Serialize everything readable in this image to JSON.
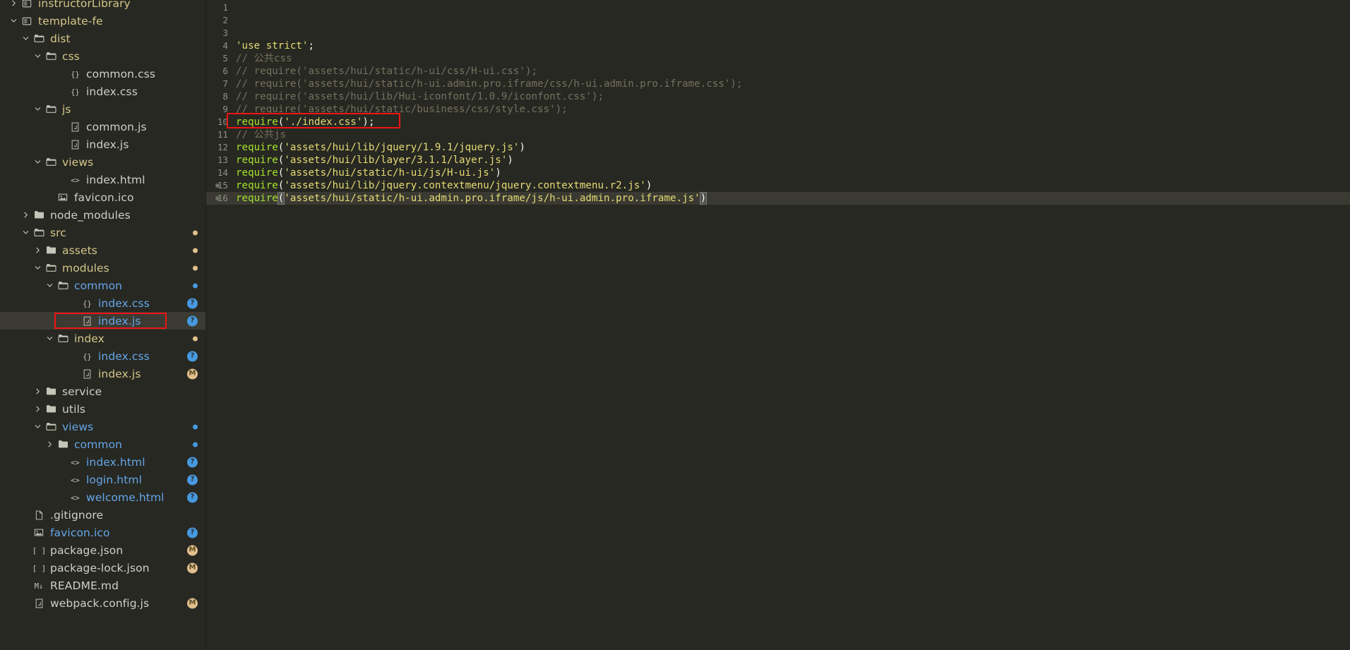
{
  "window": {
    "theme": "monokai-dark",
    "editor_background": "#272822",
    "sidebar_background": "#272822",
    "selection_outline_color": "#f01414",
    "active_line_background": "#3a3a32"
  },
  "sidebar": {
    "name": "explorer-file-tree",
    "items": [
      {
        "label": "instructorLibrary",
        "depth": 0,
        "kind": "root-folder",
        "icon": "root-folder-icon",
        "twisty": "collapsed",
        "color": "folder-amber",
        "badge": null,
        "clipped_top": true
      },
      {
        "label": "template-fe",
        "depth": 0,
        "kind": "root-folder",
        "icon": "root-folder-icon",
        "twisty": "expanded",
        "color": "folder-amber",
        "badge": null
      },
      {
        "label": "dist",
        "depth": 1,
        "kind": "folder",
        "icon": "folder-open-icon",
        "twisty": "expanded",
        "color": "folder-amber",
        "badge": null
      },
      {
        "label": "css",
        "depth": 2,
        "kind": "folder",
        "icon": "folder-open-icon",
        "twisty": "expanded",
        "color": "folder-amber",
        "badge": null
      },
      {
        "label": "common.css",
        "depth": 4,
        "kind": "file",
        "icon": "css-file-icon",
        "twisty": "none",
        "color": "plain",
        "badge": null
      },
      {
        "label": "index.css",
        "depth": 4,
        "kind": "file",
        "icon": "css-file-icon",
        "twisty": "none",
        "color": "plain",
        "badge": null
      },
      {
        "label": "js",
        "depth": 2,
        "kind": "folder",
        "icon": "folder-open-icon",
        "twisty": "expanded",
        "color": "folder-amber",
        "badge": null
      },
      {
        "label": "common.js",
        "depth": 4,
        "kind": "file",
        "icon": "js-file-icon",
        "twisty": "none",
        "color": "plain",
        "badge": null
      },
      {
        "label": "index.js",
        "depth": 4,
        "kind": "file",
        "icon": "js-file-icon",
        "twisty": "none",
        "color": "plain",
        "badge": null
      },
      {
        "label": "views",
        "depth": 2,
        "kind": "folder",
        "icon": "folder-open-icon",
        "twisty": "expanded",
        "color": "folder-amber",
        "badge": null
      },
      {
        "label": "index.html",
        "depth": 4,
        "kind": "file",
        "icon": "html-file-icon",
        "twisty": "none",
        "color": "plain",
        "badge": null
      },
      {
        "label": "favicon.ico",
        "depth": 3,
        "kind": "file",
        "icon": "image-file-icon",
        "twisty": "none",
        "color": "plain",
        "badge": null
      },
      {
        "label": "node_modules",
        "depth": 1,
        "kind": "folder",
        "icon": "folder-icon",
        "twisty": "collapsed",
        "color": "plain",
        "badge": null
      },
      {
        "label": "src",
        "depth": 1,
        "kind": "folder",
        "icon": "folder-open-icon",
        "twisty": "expanded",
        "color": "folder-amber",
        "badge": "dot-amber"
      },
      {
        "label": "assets",
        "depth": 2,
        "kind": "folder",
        "icon": "folder-icon",
        "twisty": "collapsed",
        "color": "folder-amber",
        "badge": "dot-amber"
      },
      {
        "label": "modules",
        "depth": 2,
        "kind": "folder",
        "icon": "folder-open-icon",
        "twisty": "expanded",
        "color": "folder-amber",
        "badge": "dot-amber"
      },
      {
        "label": "common",
        "depth": 3,
        "kind": "folder",
        "icon": "folder-open-icon",
        "twisty": "expanded",
        "color": "blue",
        "badge": "dot-blue"
      },
      {
        "label": "index.css",
        "depth": 5,
        "kind": "file",
        "icon": "css-file-icon",
        "twisty": "none",
        "color": "blue",
        "badge": "q"
      },
      {
        "label": "index.js",
        "depth": 5,
        "kind": "file",
        "icon": "js-file-icon",
        "twisty": "none",
        "color": "blue",
        "badge": "q",
        "selected": true,
        "highlighted": true
      },
      {
        "label": "index",
        "depth": 3,
        "kind": "folder",
        "icon": "folder-open-icon",
        "twisty": "expanded",
        "color": "folder-amber",
        "badge": "dot-amber"
      },
      {
        "label": "index.css",
        "depth": 5,
        "kind": "file",
        "icon": "css-file-icon",
        "twisty": "none",
        "color": "blue",
        "badge": "q"
      },
      {
        "label": "index.js",
        "depth": 5,
        "kind": "file",
        "icon": "js-file-icon",
        "twisty": "none",
        "color": "folder-amber",
        "badge": "m"
      },
      {
        "label": "service",
        "depth": 2,
        "kind": "folder",
        "icon": "folder-icon",
        "twisty": "collapsed",
        "color": "plain",
        "badge": null
      },
      {
        "label": "utils",
        "depth": 2,
        "kind": "folder",
        "icon": "folder-icon",
        "twisty": "collapsed",
        "color": "plain",
        "badge": null
      },
      {
        "label": "views",
        "depth": 2,
        "kind": "folder",
        "icon": "folder-open-icon",
        "twisty": "expanded",
        "color": "blue",
        "badge": "dot-blue"
      },
      {
        "label": "common",
        "depth": 3,
        "kind": "folder",
        "icon": "folder-icon",
        "twisty": "collapsed",
        "color": "blue",
        "badge": "dot-blue"
      },
      {
        "label": "index.html",
        "depth": 4,
        "kind": "file",
        "icon": "html-file-icon",
        "twisty": "none",
        "color": "blue",
        "badge": "q"
      },
      {
        "label": "login.html",
        "depth": 4,
        "kind": "file",
        "icon": "html-file-icon",
        "twisty": "none",
        "color": "blue",
        "badge": "q"
      },
      {
        "label": "welcome.html",
        "depth": 4,
        "kind": "file",
        "icon": "html-file-icon",
        "twisty": "none",
        "color": "blue",
        "badge": "q"
      },
      {
        "label": ".gitignore",
        "depth": 1,
        "kind": "file",
        "icon": "plain-file-icon",
        "twisty": "none",
        "color": "plain",
        "badge": null
      },
      {
        "label": "favicon.ico",
        "depth": 1,
        "kind": "file",
        "icon": "image-file-icon",
        "twisty": "none",
        "color": "blue",
        "badge": "q"
      },
      {
        "label": "package.json",
        "depth": 1,
        "kind": "file",
        "icon": "json-file-icon",
        "twisty": "none",
        "color": "plain",
        "badge": "m"
      },
      {
        "label": "package-lock.json",
        "depth": 1,
        "kind": "file",
        "icon": "json-file-icon",
        "twisty": "none",
        "color": "plain",
        "badge": "m"
      },
      {
        "label": "README.md",
        "depth": 1,
        "kind": "file",
        "icon": "markdown-file-icon",
        "twisty": "none",
        "color": "plain",
        "badge": null
      },
      {
        "label": "webpack.config.js",
        "depth": 1,
        "kind": "file",
        "icon": "js-file-icon",
        "twisty": "none",
        "color": "plain",
        "badge": "m"
      }
    ]
  },
  "editor": {
    "name": "code-editor",
    "active_line": 16,
    "lines": [
      {
        "n": "1",
        "segments": []
      },
      {
        "n": "2",
        "segments": []
      },
      {
        "n": "3",
        "segments": []
      },
      {
        "n": "4",
        "segments": [
          {
            "t": "'use strict'",
            "c": "str"
          },
          {
            "t": ";",
            "c": "punct"
          }
        ]
      },
      {
        "n": "5",
        "segments": [
          {
            "t": "// 公共css",
            "c": "com"
          }
        ]
      },
      {
        "n": "6",
        "segments": [
          {
            "t": "// require('assets/hui/static/h-ui/css/H-ui.css');",
            "c": "com"
          }
        ]
      },
      {
        "n": "7",
        "segments": [
          {
            "t": "// require('assets/hui/static/h-ui.admin.pro.iframe/css/h-ui.admin.pro.iframe.css');",
            "c": "com"
          }
        ]
      },
      {
        "n": "8",
        "segments": [
          {
            "t": "// require('assets/hui/lib/Hui-iconfont/1.0.9/iconfont.css');",
            "c": "com"
          }
        ]
      },
      {
        "n": "9",
        "segments": [
          {
            "t": "// require('assets/hui/static/business/css/style.css');",
            "c": "com"
          }
        ]
      },
      {
        "n": "10",
        "segments": [
          {
            "t": "require",
            "c": "fn"
          },
          {
            "t": "(",
            "c": "punct"
          },
          {
            "t": "'./index.css'",
            "c": "str"
          },
          {
            "t": ")",
            "c": "punct"
          },
          {
            "t": ";",
            "c": "punct"
          }
        ],
        "outlined": true
      },
      {
        "n": "11",
        "segments": [
          {
            "t": "// 公共js",
            "c": "com"
          }
        ]
      },
      {
        "n": "12",
        "segments": [
          {
            "t": "require",
            "c": "fn"
          },
          {
            "t": "(",
            "c": "punct"
          },
          {
            "t": "'assets/hui/lib/jquery/1.9.1/jquery.js'",
            "c": "str"
          },
          {
            "t": ")",
            "c": "punct"
          }
        ]
      },
      {
        "n": "13",
        "segments": [
          {
            "t": "require",
            "c": "fn"
          },
          {
            "t": "(",
            "c": "punct"
          },
          {
            "t": "'assets/hui/lib/layer/3.1.1/layer.js'",
            "c": "str"
          },
          {
            "t": ")",
            "c": "punct"
          }
        ]
      },
      {
        "n": "14",
        "segments": [
          {
            "t": "require",
            "c": "fn"
          },
          {
            "t": "(",
            "c": "punct"
          },
          {
            "t": "'assets/hui/static/h-ui/js/H-ui.js'",
            "c": "str"
          },
          {
            "t": ")",
            "c": "punct"
          }
        ]
      },
      {
        "n": "15",
        "segments": [
          {
            "t": "require",
            "c": "fn"
          },
          {
            "t": "(",
            "c": "punct"
          },
          {
            "t": "'assets/hui/lib/jquery.contextmenu/jquery.contextmenu.r2.js'",
            "c": "str"
          },
          {
            "t": ")",
            "c": "punct"
          }
        ],
        "gutter_dot": true
      },
      {
        "n": "16",
        "segments": [
          {
            "t": "require",
            "c": "fn"
          },
          {
            "t": "(",
            "c": "punct",
            "bracket_match": true
          },
          {
            "t": "'assets/hui/static/h-ui.admin.pro.iframe/js/h-ui.admin.pro.iframe.js'",
            "c": "str"
          },
          {
            "t": ")",
            "c": "punct",
            "bracket_match": true
          }
        ],
        "active": true,
        "gutter_dot": true
      }
    ]
  },
  "colors": {
    "string": "#e6db74",
    "function": "#a6e22e",
    "comment": "#75715e",
    "punctuation": "#f8f8f2",
    "line_number": "#8f908a",
    "accent_blue": "#64a6e8",
    "accent_amber": "#d3c689",
    "highlight_red": "#f01414"
  }
}
